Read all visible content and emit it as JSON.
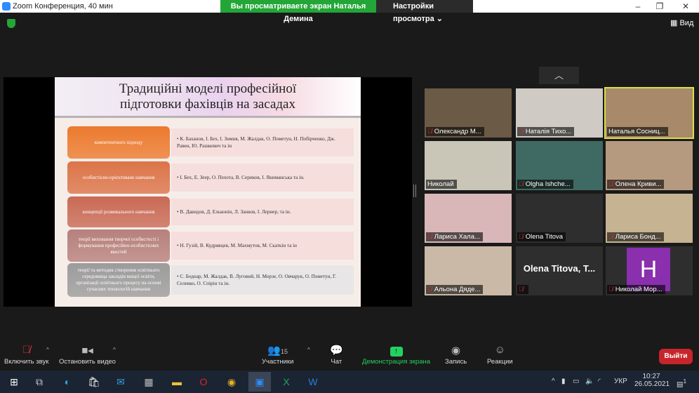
{
  "window": {
    "title": "Zoom Конференция, 40 мин",
    "banner": "Вы просматриваете экран Наталья Демина",
    "view_settings": "Настройки просмотра",
    "view_label": "Вид"
  },
  "slide": {
    "title_line1": "Традиційні моделі професійної",
    "title_line2": "підготовки фахівців на засадах",
    "rows": [
      {
        "label": "компетентного підходу",
        "text": "• К. Баханов, І. Бех, І. Зимня, М. Жалдак, О. Пометун, Н. Побірченко, Дж. Равен, Ю. Рашкевич та ін",
        "color": "#ec7a2e"
      },
      {
        "label": "особистісно-орієнтоване навчання",
        "text": "• І. Бех, Е. Зеер, О. Пехота, В. Сериков, І. Якиманська та ін.",
        "color": "#dc7448"
      },
      {
        "label": "концепції розвивального навчання",
        "text": "• В. Давидов, Д. Ельконін, Л. Занков, І. Лернер, та ін.",
        "color": "#c96a55"
      },
      {
        "label": "теорії виховання творчої особистості і формування професійно-особистісних якостей",
        "text": "• Н. Гузій, В. Кудрявцев, М. Махмутов, М. Скаткін та ін",
        "color": "#b7807c"
      },
      {
        "label": "теорії та методик створення освітнього середовища закладів вищої освіти, організації освітнього процесу на основі сучасних технологій навчання",
        "text": "• С. Боднар, М. Жалдак, В. Луговий, Н. Морзе, О. Овчарук, О. Пометун, Г. Селевко, О. Спірін та ін.",
        "color": "#9c9c9c"
      }
    ]
  },
  "participants": [
    {
      "name": "Олександр М...",
      "muted": true,
      "bg": "#6b5a45"
    },
    {
      "name": "Наталія Тихо...",
      "muted": true,
      "bg": "#cfcac4"
    },
    {
      "name": "Наталья Сосниц...",
      "muted": false,
      "bg": "#a8896a",
      "active": true
    },
    {
      "name": "Николай",
      "muted": false,
      "bg": "#c9c6b8"
    },
    {
      "name": "Olgha Ishche...",
      "muted": true,
      "bg": "#3f6a63"
    },
    {
      "name": "Олена Криви...",
      "muted": true,
      "bg": "#b69a80"
    },
    {
      "name": "Лариса Хала...",
      "muted": true,
      "bg": "#d9b7b8"
    },
    {
      "name": "Olena Titova",
      "muted": true,
      "bg": "#2e2e2e"
    },
    {
      "name": "Лариса Бонд...",
      "muted": true,
      "bg": "#c6b391"
    },
    {
      "name": "Альона Дяде...",
      "muted": true,
      "bg": "#c9b9a6"
    },
    {
      "name": "",
      "muted": true,
      "bg": "#2e2e2e",
      "big_text": "Olena Titova, T..."
    },
    {
      "name": "Николай Мор...",
      "muted": true,
      "bg": "#2e2e2e",
      "avatar": "H",
      "avatar_color": "#8a2fae"
    }
  ],
  "toolbar": {
    "unmute": "Включить звук",
    "stop_video": "Остановить видео",
    "participants": "Участники",
    "participants_count": "15",
    "chat": "Чат",
    "share": "Демонстрация экрана",
    "record": "Запись",
    "reactions": "Реакции",
    "leave": "Выйти",
    "share_color": "#23d160"
  },
  "taskbar": {
    "lang": "УКР",
    "time": "10:27",
    "date": "26.05.2021",
    "notifications": "1"
  }
}
